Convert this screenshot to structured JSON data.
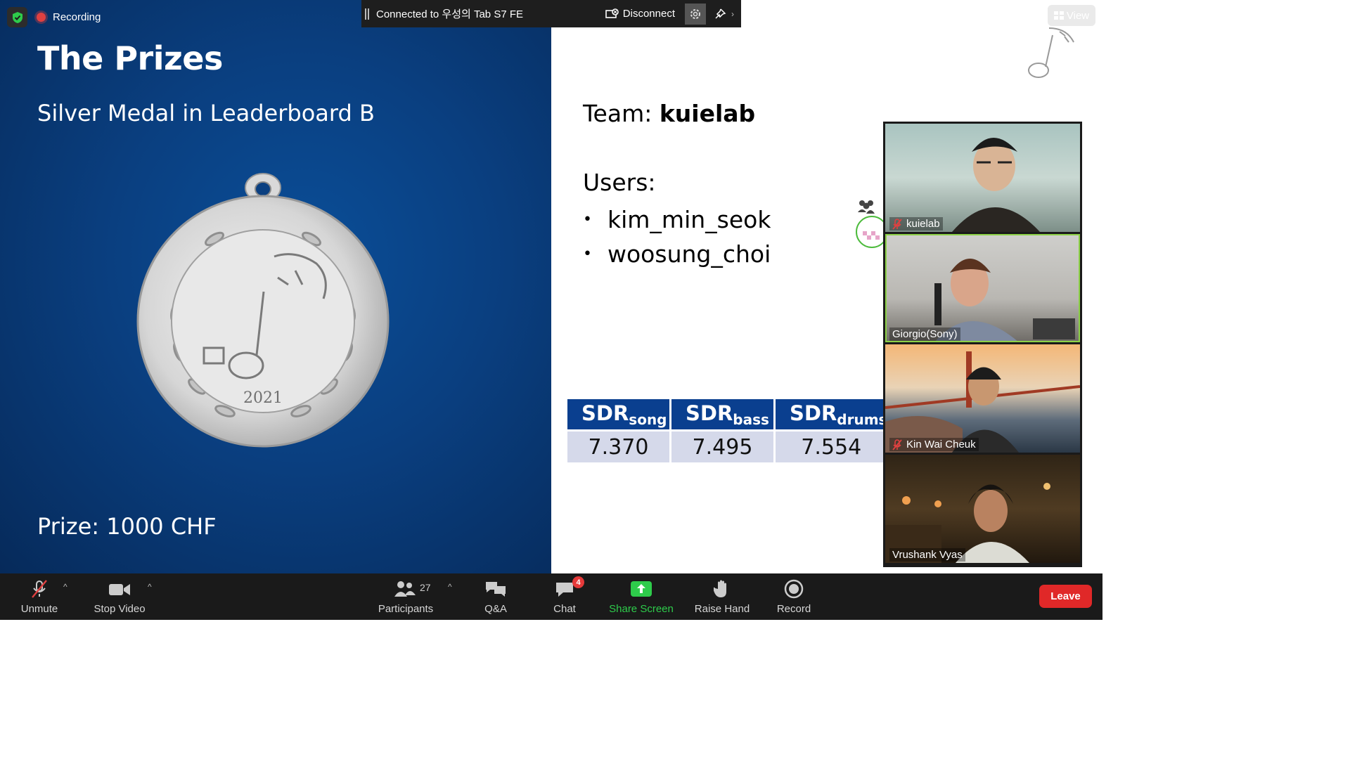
{
  "slide": {
    "left": {
      "title": "The Prizes",
      "subtitle": "Silver Medal in Leaderboard B",
      "prize": "Prize: 1000 CHF",
      "medal_year": "2021"
    },
    "right": {
      "team_prefix": "Team: ",
      "team_name": "kuielab",
      "users_label": "Users:",
      "users": [
        "kim_min_seok",
        "woosung_choi"
      ],
      "table": {
        "headers": [
          {
            "main": "SDR",
            "sub": "song"
          },
          {
            "main": "SDR",
            "sub": "bass"
          },
          {
            "main": "SDR",
            "sub": "drums"
          }
        ],
        "values": [
          "7.370",
          "7.495",
          "7.554"
        ]
      }
    }
  },
  "overlay": {
    "recording_label": "Recording",
    "connection_text": "Connected to 우성의 Tab S7 FE",
    "disconnect_label": "Disconnect",
    "view_label": "View"
  },
  "gallery": {
    "participants": [
      {
        "name": "kuielab",
        "muted": true
      },
      {
        "name": "Giorgio(Sony)",
        "muted": false
      },
      {
        "name": "Kin Wai Cheuk",
        "muted": true
      },
      {
        "name": "Vrushank Vyas",
        "muted": false
      }
    ]
  },
  "toolbar": {
    "unmute_label": "Unmute",
    "stop_video_label": "Stop Video",
    "participants_label": "Participants",
    "participants_count": "27",
    "qa_label": "Q&A",
    "chat_label": "Chat",
    "chat_badge": "4",
    "share_screen_label": "Share Screen",
    "raise_hand_label": "Raise Hand",
    "record_label": "Record",
    "leave_label": "Leave"
  },
  "colors": {
    "slide_blue": "#0a3f80",
    "table_header": "#0a3f8f",
    "table_cell": "#d5d9ea",
    "active_speaker": "#8dd147",
    "share_green": "#2ecc4b",
    "leave_red": "#e02828"
  }
}
